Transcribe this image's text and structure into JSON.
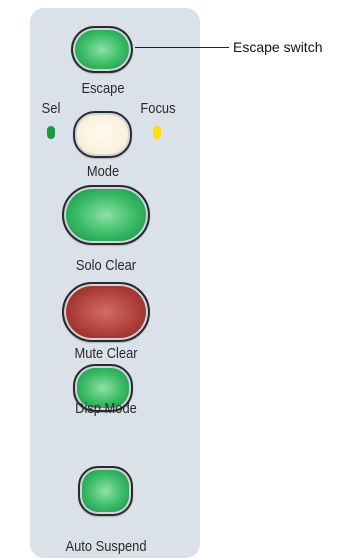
{
  "panel": {
    "escape": {
      "label": "Escape",
      "color": "green"
    },
    "sel": {
      "label": "Sel",
      "led_color": "#1a9a40"
    },
    "focus": {
      "label": "Focus",
      "led_color": "#ffe000"
    },
    "mode": {
      "label": "Mode",
      "color": "cream"
    },
    "solo_clear": {
      "label": "Solo Clear",
      "color": "green"
    },
    "mute_clear": {
      "label": "Mute Clear",
      "color": "red"
    },
    "disp_mode": {
      "label": "Disp Mode",
      "color": "green"
    },
    "auto_suspend": {
      "label": "Auto Suspend",
      "color": "green"
    }
  },
  "callout": {
    "text": "Escape switch"
  }
}
